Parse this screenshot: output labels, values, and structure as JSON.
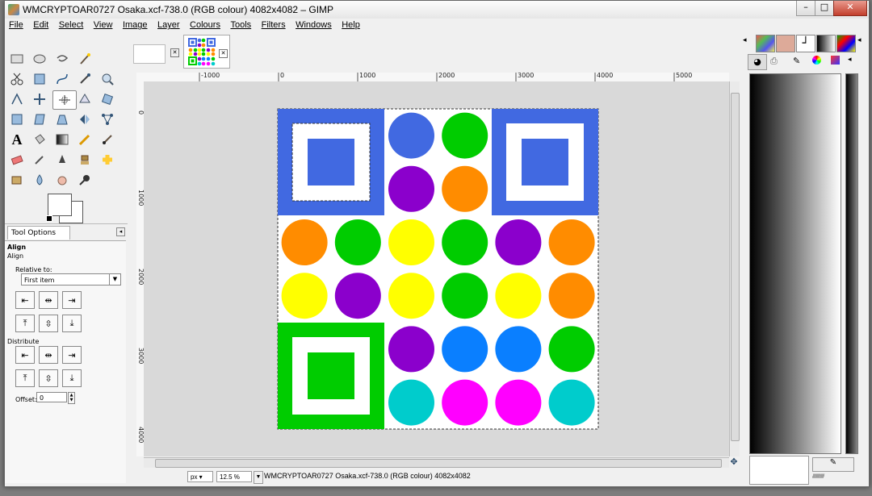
{
  "window": {
    "title": "WMCRYPTOAR0727 Osaka.xcf-738.0 (RGB colour) 4082x4082 – GIMP",
    "minimize": "–",
    "maximize": "□",
    "close": "✕"
  },
  "menu": [
    "File",
    "Edit",
    "Select",
    "View",
    "Image",
    "Layer",
    "Colours",
    "Tools",
    "Filters",
    "Windows",
    "Help"
  ],
  "tool_options": {
    "tab_label": "Tool Options",
    "tool_name": "Align",
    "tool_subtitle": "Align",
    "relative_label": "Relative to:",
    "relative_value": "First item",
    "distribute_label": "Distribute",
    "offset_label": "Offset:",
    "offset_value": "0"
  },
  "ruler": {
    "h_ticks": [
      "-1000",
      "0",
      "1000",
      "2000",
      "3000",
      "4000",
      "5000"
    ],
    "v_ticks": [
      "0",
      "1000",
      "2000",
      "3000",
      "4000"
    ]
  },
  "status": {
    "unit": "px",
    "zoom": "12.5 %",
    "text": "WMCRYPTOAR0727 Osaka.xcf-738.0 (RGB colour) 4082x4082"
  },
  "canvas_colors": {
    "blue": "#4169e1",
    "green": "#00cc00",
    "purple": "#8b00cc",
    "orange": "#ff8c00",
    "yellow": "#ffff00",
    "azure": "#0a7fff",
    "cyan": "#00cccc",
    "magenta": "#ff00ff"
  },
  "canvas_circles": [
    [
      "",
      "",
      "blue",
      "green",
      "",
      ""
    ],
    [
      "",
      "",
      "purple",
      "orange",
      "",
      ""
    ],
    [
      "orange",
      "green",
      "yellow",
      "green",
      "purple",
      "orange"
    ],
    [
      "yellow",
      "purple",
      "yellow",
      "green",
      "yellow",
      "orange"
    ],
    [
      "",
      "",
      "purple",
      "azure",
      "azure",
      "green"
    ],
    [
      "",
      "",
      "cyan",
      "magenta",
      "magenta",
      "cyan"
    ]
  ]
}
